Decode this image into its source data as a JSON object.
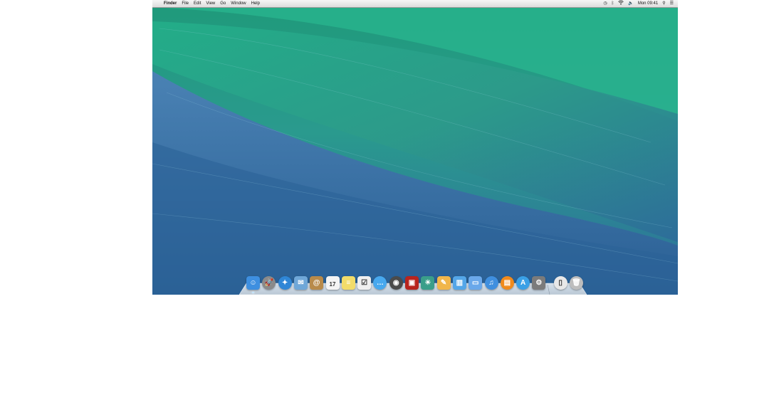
{
  "menubar": {
    "apple": "",
    "app_name": "Finder",
    "menus": [
      "File",
      "Edit",
      "View",
      "Go",
      "Window",
      "Help"
    ],
    "clock": "Mon 09:41",
    "status_icons": [
      "time-machine-icon",
      "bluetooth-icon",
      "wifi-icon",
      "volume-icon",
      "spotlight-icon",
      "notification-center-icon"
    ]
  },
  "dock": {
    "items": [
      {
        "name": "finder",
        "glyph": "☺",
        "color": "#3e8fe0",
        "running": true
      },
      {
        "name": "launchpad",
        "glyph": "🚀",
        "color": "#8a8a8a",
        "running": false
      },
      {
        "name": "safari",
        "glyph": "✦",
        "color": "#2f86d6",
        "running": false
      },
      {
        "name": "mail",
        "glyph": "✉",
        "color": "#6fa7d8",
        "running": false
      },
      {
        "name": "contacts",
        "glyph": "@",
        "color": "#b88a4a",
        "running": false
      },
      {
        "name": "calendar",
        "glyph": "17",
        "color": "#f4f4f4",
        "running": false
      },
      {
        "name": "notes",
        "glyph": "≡",
        "color": "#f2dc6a",
        "running": false
      },
      {
        "name": "reminders",
        "glyph": "☑",
        "color": "#f0f0f0",
        "running": false
      },
      {
        "name": "messages",
        "glyph": "…",
        "color": "#47a8ee",
        "running": false
      },
      {
        "name": "facetime",
        "glyph": "◉",
        "color": "#4b4b4b",
        "running": false
      },
      {
        "name": "photo-booth",
        "glyph": "▣",
        "color": "#b8241e",
        "running": false
      },
      {
        "name": "iphoto",
        "glyph": "☀",
        "color": "#3a9e8a",
        "running": false
      },
      {
        "name": "pages",
        "glyph": "✎",
        "color": "#f1b64a",
        "running": false
      },
      {
        "name": "numbers",
        "glyph": "▥",
        "color": "#54a6e8",
        "running": false
      },
      {
        "name": "keynote",
        "glyph": "▭",
        "color": "#6aa8ea",
        "running": false
      },
      {
        "name": "itunes",
        "glyph": "♫",
        "color": "#3f8fdf",
        "running": false
      },
      {
        "name": "ibooks",
        "glyph": "▤",
        "color": "#f08a1c",
        "running": false
      },
      {
        "name": "app-store",
        "glyph": "A",
        "color": "#3aa0e6",
        "running": false
      },
      {
        "name": "system-preferences",
        "glyph": "⚙",
        "color": "#7b7b7b",
        "running": false
      },
      {
        "name": "documents-stack",
        "glyph": "▯",
        "color": "#e8e8e8",
        "running": false
      },
      {
        "name": "trash",
        "glyph": "🗑",
        "color": "#bdbdbd",
        "running": false
      }
    ]
  }
}
